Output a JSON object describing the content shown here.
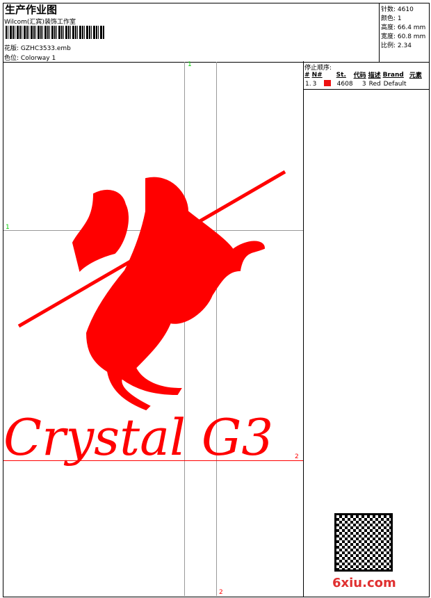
{
  "header": {
    "title": "生产作业图",
    "company": "Wilcom(汇宾)装饰工作室",
    "design_label": "花版:",
    "design_value": "GZHC3533.emb",
    "colorway_label": "色位:",
    "colorway_value": "Colorway 1"
  },
  "stats": {
    "stitches": "针数: 4610",
    "colors": "颜色: 1",
    "height": "高度: 66.4 mm",
    "width": "宽度: 60.8 mm",
    "ratio": "比例: 2.34"
  },
  "stop_sequence": {
    "title": "停止顺序:",
    "columns": [
      "#",
      "N#",
      "St.",
      "代码",
      "描述",
      "Brand",
      "元素"
    ],
    "rows": [
      {
        "index": "1.",
        "n": "3",
        "swatch": "#ee1111",
        "st": "4608",
        "code": "3",
        "desc": "Red",
        "brand": "Default"
      }
    ]
  },
  "guides": {
    "v1": "1",
    "h1": "1",
    "h2": "2",
    "v2": "2"
  },
  "design_text": "Crystal G3",
  "watermark": "6xiu.com",
  "colors": {
    "thread": "#ff0000",
    "guide": "#999999",
    "marker": "#00cc00"
  }
}
